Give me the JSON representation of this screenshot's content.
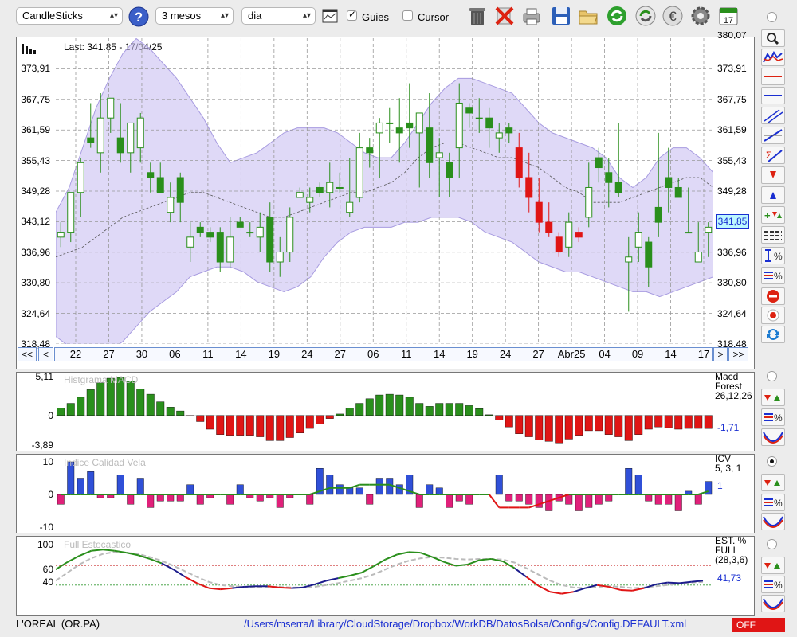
{
  "toolbar": {
    "chart_type": "CandleSticks",
    "period": "3 mesos",
    "interval": "dia",
    "guides_label": "Guies",
    "guides_checked": true,
    "cursor_label": "Cursor",
    "cursor_checked": false,
    "icons": [
      "help-icon",
      "chart-window-icon",
      "trash-icon",
      "delete-x-icon",
      "print-icon",
      "save-icon",
      "open-folder-icon",
      "refresh-icon",
      "sync-icon",
      "currency-icon",
      "gear-icon",
      "calendar-icon"
    ],
    "calendar_day": "17"
  },
  "main_chart": {
    "last_label": "Last: 341.85 - 17/04/25",
    "current_price": "341,85",
    "y_ticks": [
      "373,91",
      "367,75",
      "361,59",
      "355,43",
      "349,28",
      "343,12",
      "336,96",
      "330,80",
      "324,64",
      "318,48"
    ],
    "top_cut_label": "380,07",
    "date_labels": [
      "22",
      "27",
      "30",
      "06",
      "11",
      "14",
      "19",
      "24",
      "27",
      "06",
      "11",
      "14",
      "19",
      "24",
      "27",
      "Abr25",
      "04",
      "09",
      "14",
      "17"
    ],
    "nav_prev_all": "<<",
    "nav_prev": "<",
    "nav_next": ">",
    "nav_next_all": ">>"
  },
  "macd_panel": {
    "title": "Histgrama MACD",
    "y_ticks": [
      "5,11",
      "0",
      "-3,89"
    ],
    "legend": [
      "Macd",
      "Forest",
      "26,12,26"
    ],
    "value": "-1,71"
  },
  "icv_panel": {
    "title": "Indice Calidad Vela",
    "y_ticks": [
      "10",
      "0",
      "-10"
    ],
    "legend": [
      "ICV",
      "5, 3, 1"
    ],
    "value": "1"
  },
  "stoch_panel": {
    "title": "Full Estocastico",
    "y_ticks": [
      "100",
      "60",
      "40"
    ],
    "legend": [
      "EST. %",
      "FULL",
      "(28,3,6)"
    ],
    "value": "41,73"
  },
  "status": {
    "ticker": "L'OREAL (OR.PA)",
    "path": "/Users/mserra/Library/CloudStorage/Dropbox/WorkDB/DatosBolsa/Configs/Config.DEFAULT.xml",
    "off_label": "OFF"
  },
  "colors": {
    "up": "#2a8f1c",
    "down": "#e01515",
    "band": "#c9bff2",
    "accent": "#1a2fd1",
    "icv_pos": "#3050d8",
    "icv_neg": "#e0207a"
  },
  "chart_data": [
    {
      "type": "candlestick",
      "title": "Last: 341.85 - 17/04/25",
      "ylim": [
        318.48,
        380.07
      ],
      "candles": [
        [
          340,
          343,
          338,
          341
        ],
        [
          341,
          349,
          339,
          349
        ],
        [
          349,
          356,
          344,
          355
        ],
        [
          360,
          367,
          358,
          359
        ],
        [
          357,
          369,
          353,
          364
        ],
        [
          364,
          368,
          361,
          368
        ],
        [
          360,
          367,
          355,
          357
        ],
        [
          357,
          362,
          353,
          363
        ],
        [
          358,
          365,
          355,
          364
        ],
        [
          353,
          355,
          349,
          352
        ],
        [
          352,
          355,
          350,
          349
        ],
        [
          345,
          351,
          343,
          348
        ],
        [
          352,
          353,
          343,
          347
        ],
        [
          338,
          343,
          335,
          340
        ],
        [
          342,
          343,
          340,
          341
        ],
        [
          341,
          342,
          339,
          340
        ],
        [
          341,
          342,
          333,
          335
        ],
        [
          335,
          344,
          334,
          340
        ],
        [
          343,
          344,
          342,
          342
        ],
        [
          341,
          343,
          340,
          341
        ],
        [
          340,
          345,
          337,
          342
        ],
        [
          344,
          347,
          333,
          335
        ],
        [
          335,
          340,
          332,
          337
        ],
        [
          337,
          346,
          335,
          344
        ],
        [
          348,
          350,
          348,
          349
        ],
        [
          347,
          350,
          345,
          348
        ],
        [
          350,
          351,
          348,
          349
        ],
        [
          349,
          355,
          346,
          351
        ],
        [
          350,
          353,
          349,
          350
        ],
        [
          345,
          356,
          344,
          347
        ],
        [
          348,
          361,
          347,
          358
        ],
        [
          358,
          360,
          354,
          357
        ],
        [
          361,
          364,
          352,
          363
        ],
        [
          363,
          366,
          359,
          363
        ],
        [
          362,
          368,
          355,
          361
        ],
        [
          363,
          371,
          358,
          362
        ],
        [
          361,
          365,
          350,
          365
        ],
        [
          362,
          369,
          352,
          355
        ],
        [
          356,
          360,
          348,
          357
        ],
        [
          355,
          357,
          348,
          352
        ],
        [
          358,
          371,
          352,
          367
        ],
        [
          366,
          367,
          362,
          365
        ],
        [
          364,
          368,
          361,
          364
        ],
        [
          364,
          366,
          358,
          362
        ],
        [
          360,
          363,
          357,
          361
        ],
        [
          362,
          363,
          359,
          361
        ],
        [
          358,
          361,
          350,
          352
        ],
        [
          352,
          357,
          345,
          348
        ],
        [
          347,
          352,
          341,
          343
        ],
        [
          343,
          347,
          340,
          341
        ],
        [
          340,
          341,
          336,
          337
        ],
        [
          338,
          345,
          336,
          343
        ],
        [
          341,
          342,
          339,
          340
        ],
        [
          344,
          355,
          342,
          350
        ],
        [
          356,
          358,
          351,
          354
        ],
        [
          353,
          356,
          346,
          351
        ],
        [
          351,
          363,
          348,
          349
        ],
        [
          335,
          340,
          325,
          336
        ],
        [
          338,
          345,
          335,
          341
        ],
        [
          339,
          340,
          330,
          334
        ],
        [
          346,
          361,
          340,
          343
        ],
        [
          352,
          358,
          345,
          350
        ],
        [
          350,
          352,
          348,
          348
        ],
        [
          341,
          350,
          341,
          341
        ],
        [
          335,
          343,
          336,
          337
        ],
        [
          341,
          343,
          336,
          342
        ]
      ],
      "bollinger_upper": [
        345,
        350,
        358,
        366,
        372,
        377,
        380,
        378,
        375,
        372,
        368,
        364,
        359,
        355,
        356,
        357,
        359,
        361,
        362,
        362,
        362,
        361,
        359,
        357,
        356,
        356,
        359,
        363,
        367,
        370,
        372,
        372,
        371,
        370,
        369,
        366,
        363,
        361,
        360,
        359,
        358,
        356,
        352,
        350,
        352,
        356,
        358,
        358,
        356,
        353
      ],
      "bollinger_lower": [
        320,
        318,
        316,
        316,
        317,
        319,
        322,
        325,
        327,
        329,
        332,
        333,
        334,
        334,
        333,
        331,
        330,
        329,
        330,
        332,
        336,
        339,
        341,
        342,
        342,
        342,
        343,
        343,
        344,
        344,
        344,
        343,
        341,
        340,
        339,
        337,
        335,
        334,
        333,
        333,
        332,
        331,
        330,
        329,
        329,
        328,
        329,
        330,
        331,
        332
      ],
      "sma_mid": [
        336,
        337,
        338,
        340,
        342,
        344,
        345,
        346,
        347,
        348,
        349,
        349,
        348,
        347,
        346,
        345,
        344,
        344,
        345,
        346,
        347,
        348,
        349,
        349,
        350,
        351,
        353,
        356,
        358,
        359,
        359,
        358,
        357,
        356,
        356,
        355,
        354,
        352,
        350,
        349,
        347,
        347,
        347,
        348,
        349,
        350,
        351,
        352,
        352,
        350
      ]
    },
    {
      "type": "bar",
      "title": "Histgrama MACD",
      "ylim": [
        -3.89,
        5.11
      ],
      "values": [
        1.0,
        1.6,
        2.4,
        3.4,
        4.3,
        4.9,
        5.0,
        4.5,
        3.5,
        2.8,
        1.8,
        1.1,
        0.6,
        -0.1,
        -0.8,
        -1.8,
        -2.5,
        -2.6,
        -2.6,
        -2.6,
        -2.8,
        -3.3,
        -3.3,
        -2.9,
        -2.3,
        -1.7,
        -1.1,
        -0.4,
        0.2,
        1.0,
        1.6,
        2.2,
        2.7,
        2.8,
        2.7,
        2.4,
        1.6,
        1.2,
        1.6,
        1.6,
        1.6,
        1.3,
        0.9,
        0.1,
        -0.6,
        -1.5,
        -2.4,
        -2.8,
        -3.2,
        -3.4,
        -3.6,
        -3.1,
        -2.6,
        -2.0,
        -2.0,
        -2.5,
        -2.8,
        -3.3,
        -2.5,
        -1.8,
        -1.5,
        -1.6,
        -1.8,
        -1.7,
        -1.7,
        -1.71
      ]
    },
    {
      "type": "bar",
      "title": "Indice Calidad Vela",
      "ylim": [
        -10,
        10
      ],
      "values": [
        -3,
        10,
        5,
        7,
        -1,
        -1,
        6,
        -3,
        5,
        -4,
        -2,
        -2,
        -2,
        3,
        -3,
        -1,
        0,
        -3,
        3,
        -1,
        -2,
        -1,
        -4,
        -1,
        0,
        -3,
        8,
        6,
        3,
        2,
        2,
        -3,
        5,
        5,
        3,
        6,
        -4,
        3,
        2,
        -4,
        -2,
        -3,
        0,
        0,
        6,
        -2,
        -2,
        -3,
        -4,
        -5,
        -2,
        -3,
        -5,
        -4,
        -3,
        -2,
        0,
        8,
        6,
        -2,
        -3,
        -3,
        -5,
        1,
        -3,
        4
      ],
      "line": [
        0,
        0,
        0,
        0,
        0,
        0,
        0,
        0,
        0,
        0,
        0,
        0,
        0,
        0,
        0,
        0,
        0,
        0,
        0,
        0,
        0,
        0,
        0,
        0,
        0,
        0,
        1,
        2,
        2,
        2,
        3,
        3,
        3,
        3,
        2,
        1,
        0,
        0,
        0,
        0,
        0,
        0,
        0,
        0,
        -4,
        -4,
        -4,
        -4,
        -3,
        -2,
        -1,
        0,
        0,
        0,
        0,
        0,
        0,
        0,
        0,
        0,
        0,
        0,
        0,
        0,
        0,
        1
      ]
    },
    {
      "type": "line",
      "title": "Full Estocastico",
      "ylim": [
        0,
        100
      ],
      "series": [
        {
          "values": [
            60,
            72,
            82,
            90,
            92,
            90,
            87,
            83,
            77,
            70,
            60,
            48,
            38,
            30,
            28,
            30,
            32,
            33,
            33,
            31,
            30,
            31,
            36,
            42,
            46,
            50,
            55,
            65,
            76,
            84,
            88,
            87,
            80,
            72,
            66,
            68,
            75,
            77,
            73,
            62,
            48,
            34,
            24,
            21,
            24,
            30,
            35,
            32,
            27,
            26,
            30,
            36,
            39,
            38,
            40,
            42
          ]
        },
        {
          "values": [
            42,
            55,
            68,
            78,
            85,
            88,
            87,
            85,
            80,
            74,
            66,
            57,
            48,
            40,
            35,
            33,
            32,
            32,
            32,
            32,
            31,
            31,
            32,
            35,
            38,
            42,
            46,
            52,
            60,
            68,
            74,
            78,
            80,
            79,
            77,
            76,
            77,
            77,
            76,
            71,
            62,
            52,
            42,
            35,
            31,
            30,
            32,
            33,
            32,
            30,
            31,
            33,
            35,
            37,
            39,
            40
          ]
        }
      ]
    }
  ]
}
